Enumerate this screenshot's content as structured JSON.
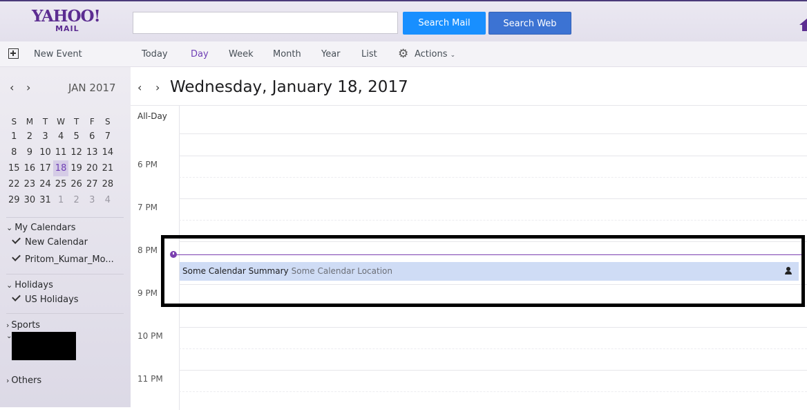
{
  "header": {
    "logo_brand": "YAHOO!",
    "logo_sub": "MAIL",
    "search_placeholder": "",
    "search_mail": "Search Mail",
    "search_web": "Search Web"
  },
  "toolbar": {
    "new_event": "New Event",
    "views": [
      "Today",
      "Day",
      "Week",
      "Month",
      "Year",
      "List"
    ],
    "active_view": "Day",
    "actions": "Actions"
  },
  "mini_calendar": {
    "month": "JAN 2017",
    "weekdays": [
      "S",
      "M",
      "T",
      "W",
      "T",
      "F",
      "S"
    ],
    "weeks": [
      [
        "1",
        "2",
        "3",
        "4",
        "5",
        "6",
        "7"
      ],
      [
        "8",
        "9",
        "10",
        "11",
        "12",
        "13",
        "14"
      ],
      [
        "15",
        "16",
        "17",
        "18",
        "19",
        "20",
        "21"
      ],
      [
        "22",
        "23",
        "24",
        "25",
        "26",
        "27",
        "28"
      ],
      [
        "29",
        "30",
        "31",
        "1",
        "2",
        "3",
        "4"
      ]
    ],
    "selected": "18"
  },
  "sidebar": {
    "my_calendars": "My Calendars",
    "my_calendar_items": [
      "New Calendar",
      "Pritom_Kumar_Mo..."
    ],
    "holidays": "Holidays",
    "holiday_items": [
      "US Holidays"
    ],
    "sports": "Sports",
    "others": "Others"
  },
  "main": {
    "title": "Wednesday, January 18, 2017",
    "all_day": "All-Day",
    "times": [
      "6 PM",
      "7 PM",
      "8 PM",
      "9 PM",
      "10 PM",
      "11 PM"
    ]
  },
  "event": {
    "summary": "Some Calendar Summary",
    "location": "Some Calendar Location"
  },
  "colors": {
    "brand": "#5c2d91",
    "accent": "#7b3fb0",
    "search_mail_btn": "#188fff",
    "search_web_btn": "#3c73d3",
    "event_bg": "#cfdcf5"
  }
}
